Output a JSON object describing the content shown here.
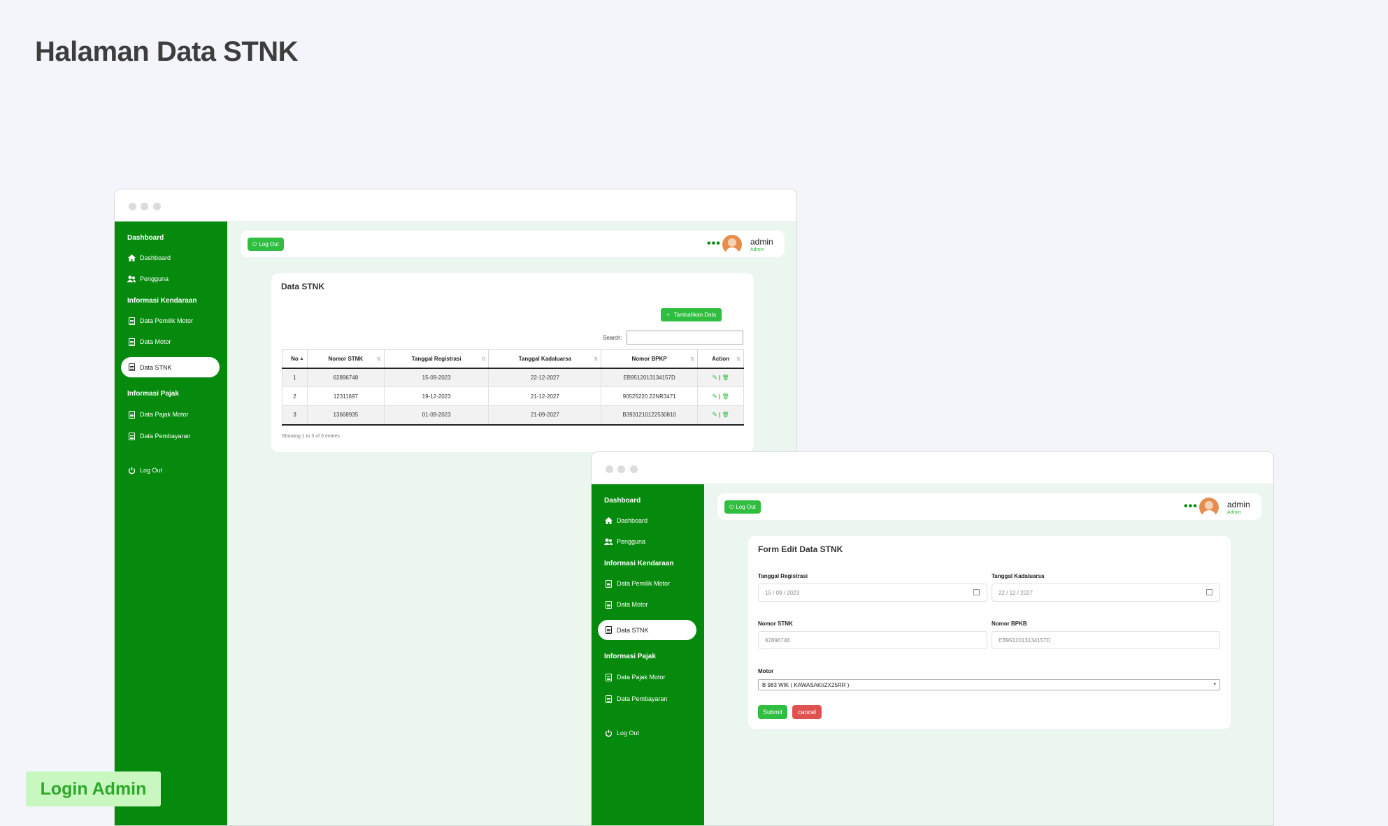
{
  "page_title": "Halaman Data STNK",
  "badge": "Login Admin",
  "sidebar": {
    "section_dashboard": "Dashboard",
    "dashboard": "Dashboard",
    "pengguna": "Pengguna",
    "section_kendaraan": "Informasi Kendaraan",
    "pemilik_motor": "Data Pemilik Motor",
    "data_motor": "Data Motor",
    "data_stnk": "Data STNK",
    "section_pajak": "Informasi Pajak",
    "pajak_motor": "Data Pajak Motor",
    "pembayaran": "Data Pembayaran",
    "logout": "Log Out"
  },
  "topbar": {
    "logout_label": "Log Out",
    "more": "•••",
    "user_name": "admin",
    "user_role": "Admin"
  },
  "list_window": {
    "card_title": "Data STNK",
    "add_button": "Tambahkan Data",
    "search_label": "Search:",
    "search_value": "",
    "columns": [
      "No",
      "Nomor STNK",
      "Tanggal Registrasi",
      "Tanggal Kadaluarsa",
      "Nomor BPKP",
      "Action"
    ],
    "rows": [
      [
        "1",
        "62896748",
        "15-09-2023",
        "22-12-2027",
        "EB9512013134157D"
      ],
      [
        "2",
        "12311697",
        "19-12-2023",
        "21-12-2027",
        "90525220 22NR3471"
      ],
      [
        "3",
        "13668935",
        "01-09-2023",
        "21-09-2027",
        "B3931210122530810"
      ]
    ],
    "info": "Showing 1 to 3 of 3 entries"
  },
  "form_window": {
    "card_title": "Form Edit Data STNK",
    "tgl_registrasi_label": "Tanggal Registrasi",
    "tgl_registrasi_value": "15 / 09 / 2023",
    "tgl_kadaluarsa_label": "Tanggal Kadaluarsa",
    "tgl_kadaluarsa_value": "22 / 12 / 2027",
    "nomor_stnk_label": "Nomor STNK",
    "nomor_stnk_value": "62896748",
    "nomor_bpkb_label": "Nomor BPKB",
    "nomor_bpkb_value": "EB9512013134157D",
    "motor_label": "Motor",
    "motor_value": "B 983 WIK ( KAWASAKI/ZX25RR )",
    "submit": "Submit",
    "cancel": "cancel"
  },
  "colors": {
    "sidebar_green": "#058a0d",
    "button_green": "#2fbe3f",
    "cancel_red": "#e05252",
    "content_bg": "#ebf6ee",
    "badge_bg": "#c8f7c0"
  }
}
